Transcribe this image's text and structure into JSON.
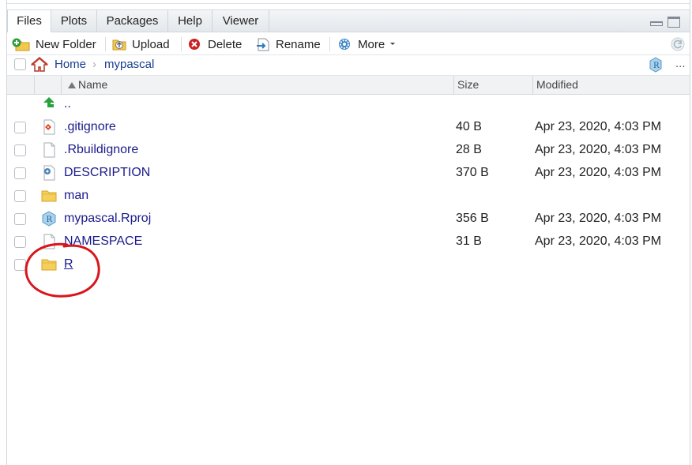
{
  "tabs": [
    "Files",
    "Plots",
    "Packages",
    "Help",
    "Viewer"
  ],
  "toolbar": {
    "new_folder": "New Folder",
    "upload": "Upload",
    "delete": "Delete",
    "rename": "Rename",
    "more": "More"
  },
  "breadcrumb": {
    "home": "Home",
    "separator": "›",
    "current": "mypascal"
  },
  "overflow": "...",
  "columns": {
    "name": "Name",
    "size": "Size",
    "modified": "Modified"
  },
  "parent_label": "..",
  "files": [
    {
      "name": ".gitignore",
      "size": "40 B",
      "modified": "Apr 23, 2020, 4:03 PM",
      "icon": "git-file-icon"
    },
    {
      "name": ".Rbuildignore",
      "size": "28 B",
      "modified": "Apr 23, 2020, 4:03 PM",
      "icon": "file-icon"
    },
    {
      "name": "DESCRIPTION",
      "size": "370 B",
      "modified": "Apr 23, 2020, 4:03 PM",
      "icon": "description-file-icon"
    },
    {
      "name": "man",
      "size": "",
      "modified": "",
      "icon": "folder-icon"
    },
    {
      "name": "mypascal.Rproj",
      "size": "356 B",
      "modified": "Apr 23, 2020, 4:03 PM",
      "icon": "rproj-file-icon"
    },
    {
      "name": "NAMESPACE",
      "size": "31 B",
      "modified": "Apr 23, 2020, 4:03 PM",
      "icon": "file-icon"
    },
    {
      "name": "R",
      "size": "",
      "modified": "",
      "icon": "folder-icon"
    }
  ],
  "colors": {
    "link": "#1a3d8f",
    "file_link": "#1a1a8c",
    "annotation": "#d9151b",
    "header_bg": "#f0f2f4"
  }
}
